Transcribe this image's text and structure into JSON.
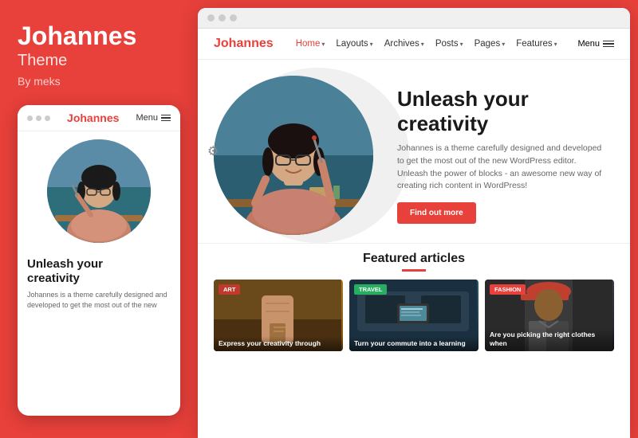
{
  "left": {
    "title_line1": "Johannes",
    "title_line2": "Theme",
    "by": "By meks",
    "mobile": {
      "logo": "Johannes",
      "menu_label": "Menu",
      "hero_heading_line1": "Unleash your",
      "hero_heading_line2": "creativity",
      "desc": "Johannes is a theme carefully designed and developed to get the most out of the new"
    }
  },
  "right": {
    "chrome_dots": [
      "dot1",
      "dot2",
      "dot3"
    ],
    "nav": {
      "logo": "Johannes",
      "items": [
        {
          "label": "Home",
          "has_arrow": true,
          "active": true
        },
        {
          "label": "Layouts",
          "has_arrow": true
        },
        {
          "label": "Archives",
          "has_arrow": true
        },
        {
          "label": "Posts",
          "has_arrow": true
        },
        {
          "label": "Pages",
          "has_arrow": true
        },
        {
          "label": "Features",
          "has_arrow": true
        },
        {
          "label": "Menu",
          "is_menu": true
        }
      ]
    },
    "hero": {
      "heading_line1": "Unleash your",
      "heading_line2": "creativity",
      "desc": "Johannes is a theme carefully designed and developed to get the most out of the new WordPress editor. Unleash the power of blocks - an awesome new way of creating rich content in WordPress!",
      "cta_label": "Find out more"
    },
    "featured": {
      "title": "Featured articles",
      "articles": [
        {
          "tag": "Art",
          "tag_class": "tag-art",
          "bg_class": "art-bg",
          "title": "Express your creativity through"
        },
        {
          "tag": "Travel",
          "tag_class": "tag-travel",
          "bg_class": "travel-bg",
          "title": "Turn your commute into a learning"
        },
        {
          "tag": "Fashion",
          "tag_class": "tag-fashion",
          "bg_class": "fashion-bg",
          "title": "Are you picking the right clothes when"
        }
      ]
    }
  }
}
